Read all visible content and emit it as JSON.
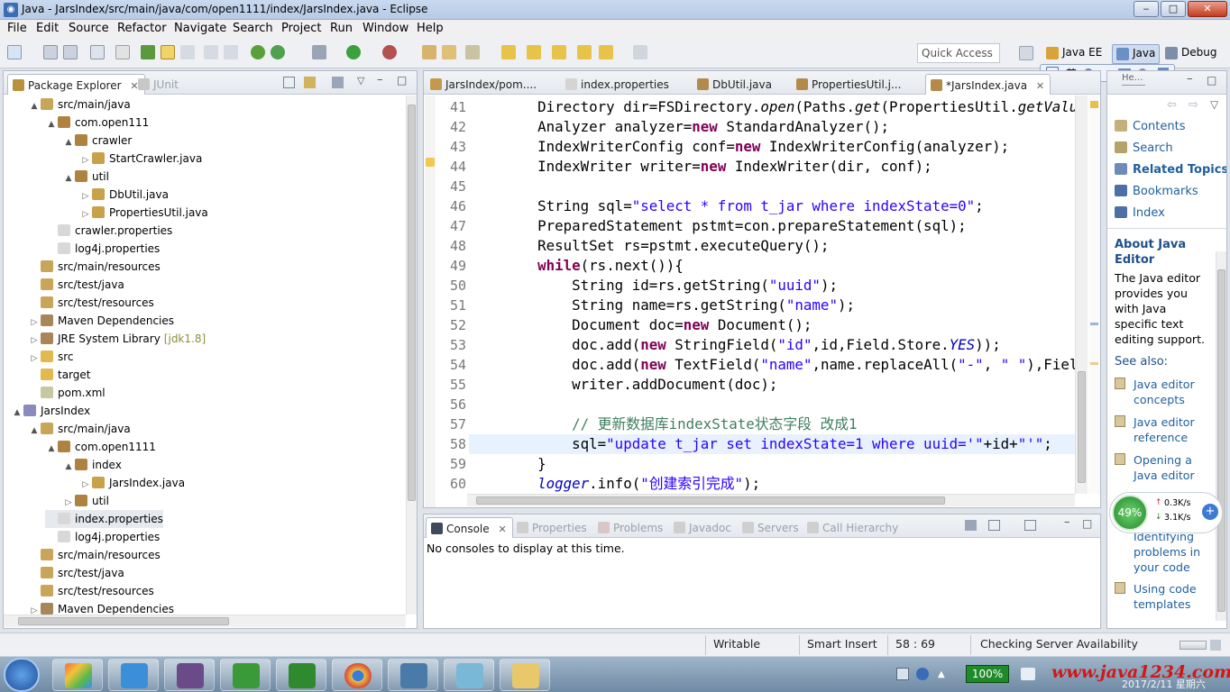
{
  "window": {
    "title": "Java - JarsIndex/src/main/java/com/open1111/index/JarsIndex.java - Eclipse",
    "minimize": "‒",
    "maximize": "□",
    "close": "✕"
  },
  "menu": [
    "File",
    "Edit",
    "Source",
    "Refactor",
    "Navigate",
    "Search",
    "Project",
    "Run",
    "Window",
    "Help"
  ],
  "toolbar": {
    "quick_access_placeholder": "Quick Access",
    "perspectives": [
      "Java EE",
      "Java",
      "Debug"
    ],
    "ime_label": "英"
  },
  "package_explorer": {
    "tab_label": "Package Explorer",
    "junit_label": "JUnit",
    "close_glyph": "✕",
    "tree": [
      {
        "label": "src/main/java",
        "depth": 1,
        "twisty": "▲",
        "icon": "srcfolder"
      },
      {
        "label": "com.open111",
        "depth": 2,
        "twisty": "▲",
        "icon": "package"
      },
      {
        "label": "crawler",
        "depth": 3,
        "twisty": "▲",
        "icon": "package"
      },
      {
        "label": "StartCrawler.java",
        "depth": 4,
        "twisty": "▷",
        "icon": "java"
      },
      {
        "label": "util",
        "depth": 3,
        "twisty": "▲",
        "icon": "package"
      },
      {
        "label": "DbUtil.java",
        "depth": 4,
        "twisty": "▷",
        "icon": "java"
      },
      {
        "label": "PropertiesUtil.java",
        "depth": 4,
        "twisty": "▷",
        "icon": "java"
      },
      {
        "label": "crawler.properties",
        "depth": 2,
        "twisty": "",
        "icon": "file"
      },
      {
        "label": "log4j.properties",
        "depth": 2,
        "twisty": "",
        "icon": "file"
      },
      {
        "label": "src/main/resources",
        "depth": 1,
        "twisty": "",
        "icon": "srcfolder"
      },
      {
        "label": "src/test/java",
        "depth": 1,
        "twisty": "",
        "icon": "srcfolder"
      },
      {
        "label": "src/test/resources",
        "depth": 1,
        "twisty": "",
        "icon": "srcfolder"
      },
      {
        "label": "Maven Dependencies",
        "depth": 1,
        "twisty": "▷",
        "icon": "lib"
      },
      {
        "label": "JRE System Library",
        "depth": 1,
        "twisty": "▷",
        "icon": "lib",
        "deco": "[jdk1.8]"
      },
      {
        "label": "src",
        "depth": 1,
        "twisty": "▷",
        "icon": "folder"
      },
      {
        "label": "target",
        "depth": 1,
        "twisty": "",
        "icon": "folder"
      },
      {
        "label": "pom.xml",
        "depth": 1,
        "twisty": "",
        "icon": "xml"
      },
      {
        "label": "JarsIndex",
        "depth": 0,
        "twisty": "▲",
        "icon": "project"
      },
      {
        "label": "src/main/java",
        "depth": 1,
        "twisty": "▲",
        "icon": "srcfolder"
      },
      {
        "label": "com.open1111",
        "depth": 2,
        "twisty": "▲",
        "icon": "package"
      },
      {
        "label": "index",
        "depth": 3,
        "twisty": "▲",
        "icon": "package"
      },
      {
        "label": "JarsIndex.java",
        "depth": 4,
        "twisty": "▷",
        "icon": "java"
      },
      {
        "label": "util",
        "depth": 3,
        "twisty": "▷",
        "icon": "package"
      },
      {
        "label": "index.properties",
        "depth": 2,
        "twisty": "",
        "icon": "file",
        "selected": true
      },
      {
        "label": "log4j.properties",
        "depth": 2,
        "twisty": "",
        "icon": "file"
      },
      {
        "label": "src/main/resources",
        "depth": 1,
        "twisty": "",
        "icon": "srcfolder"
      },
      {
        "label": "src/test/java",
        "depth": 1,
        "twisty": "",
        "icon": "srcfolder"
      },
      {
        "label": "src/test/resources",
        "depth": 1,
        "twisty": "",
        "icon": "srcfolder"
      },
      {
        "label": "Maven Dependencies",
        "depth": 1,
        "twisty": "▷",
        "icon": "lib"
      }
    ]
  },
  "editor": {
    "tabs": [
      "JarsIndex/pom....",
      "index.properties",
      "DbUtil.java",
      "PropertiesUtil.j...",
      "*JarsIndex.java"
    ],
    "active_tab": 4,
    "line_numbers": [
      "41",
      "42",
      "43",
      "44",
      "45",
      "46",
      "47",
      "48",
      "49",
      "50",
      "51",
      "52",
      "53",
      "54",
      "55",
      "56",
      "57",
      "58",
      "59",
      "60"
    ],
    "lines": [
      "        Directory dir=FSDirectory.open(Paths.get(PropertiesUtil.getValue",
      "        Analyzer analyzer=new StandardAnalyzer();",
      "        IndexWriterConfig conf=new IndexWriterConfig(analyzer);",
      "        IndexWriter writer=new IndexWriter(dir, conf);",
      "",
      "        String sql=\"select * from t_jar where indexState=0\";",
      "        PreparedStatement pstmt=con.prepareStatement(sql);",
      "        ResultSet rs=pstmt.executeQuery();",
      "        while(rs.next()){",
      "            String id=rs.getString(\"uuid\");",
      "            String name=rs.getString(\"name\");",
      "            Document doc=new Document();",
      "            doc.add(new StringField(\"id\",id,Field.Store.YES));",
      "            doc.add(new TextField(\"name\",name.replaceAll(\"-\", \" \"),Field",
      "            writer.addDocument(doc);",
      "",
      "            // 更新数据库indexState状态字段 改成1",
      "            sql=\"update t_jar set indexState=1 where uuid='\"+id+\"'\";",
      "        }",
      "        logger.info(\"创建索引完成\");"
    ]
  },
  "console": {
    "tabs": [
      "Console",
      "Properties",
      "Problems",
      "Javadoc",
      "Servers",
      "Call Hierarchy"
    ],
    "message": "No consoles to display at this time."
  },
  "help": {
    "links": [
      "Contents",
      "Search",
      "Related Topics",
      "Bookmarks",
      "Index"
    ],
    "about_title": "About Java Editor",
    "about_text": "The Java editor provides you with Java specific text editing support.",
    "see_also": "See also:",
    "see_also_links": [
      "Java editor concepts",
      "Java editor reference",
      "Opening a Java editor",
      "Identifying problems in your code",
      "Using code templates"
    ],
    "net_percent": "49%",
    "net_up": "0.3K/s",
    "net_down": "3.1K/s"
  },
  "status": {
    "writable": "Writable",
    "insert_mode": "Smart Insert",
    "position": "58 : 69",
    "task": "Checking Server Availability"
  },
  "taskbar": {
    "battery": "100%",
    "watermark": "www.java1234.com",
    "date": "2017/2/11 星期六"
  }
}
